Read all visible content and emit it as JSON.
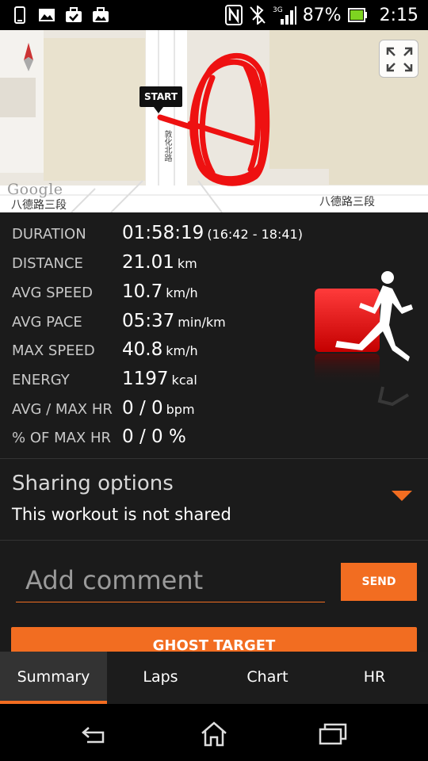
{
  "status_bar": {
    "battery": "87%",
    "time": "2:15",
    "network": "3G",
    "icons": [
      "phone-icon",
      "image-icon",
      "briefcase-check-icon",
      "briefcase-image-icon",
      "nfc-icon",
      "bluetooth-icon",
      "signal-icon",
      "battery-icon"
    ]
  },
  "map": {
    "start_label": "START",
    "street_left": "八德路三段",
    "street_right": "八德路三段",
    "street_vertical": "敦化北路",
    "google_label": "Google",
    "route_color": "#ee1111"
  },
  "stats": [
    {
      "label": "DURATION",
      "value": "01:58:19",
      "unit": "(16:42 - 18:41)"
    },
    {
      "label": "DISTANCE",
      "value": "21.01",
      "unit": "km"
    },
    {
      "label": "AVG SPEED",
      "value": "10.7",
      "unit": "km/h"
    },
    {
      "label": "AVG PACE",
      "value": "05:37",
      "unit": "min/km"
    },
    {
      "label": "MAX SPEED",
      "value": "40.8",
      "unit": "km/h"
    },
    {
      "label": "ENERGY",
      "value": "1197",
      "unit": "kcal"
    },
    {
      "label": "AVG / MAX HR",
      "value": "0 / 0",
      "unit": "bpm"
    },
    {
      "label": "% OF MAX HR",
      "value": "0 / 0 %",
      "unit": ""
    }
  ],
  "sharing": {
    "title": "Sharing options",
    "status": "This workout is not shared"
  },
  "comment": {
    "placeholder": "Add comment",
    "send_label": "SEND"
  },
  "ghost_target_label": "GHOST TARGET",
  "tabs": [
    {
      "label": "Summary",
      "active": true
    },
    {
      "label": "Laps",
      "active": false
    },
    {
      "label": "Chart",
      "active": false
    },
    {
      "label": "HR",
      "active": false
    }
  ],
  "colors": {
    "accent": "#f26d21",
    "background": "#1b1b1b"
  }
}
